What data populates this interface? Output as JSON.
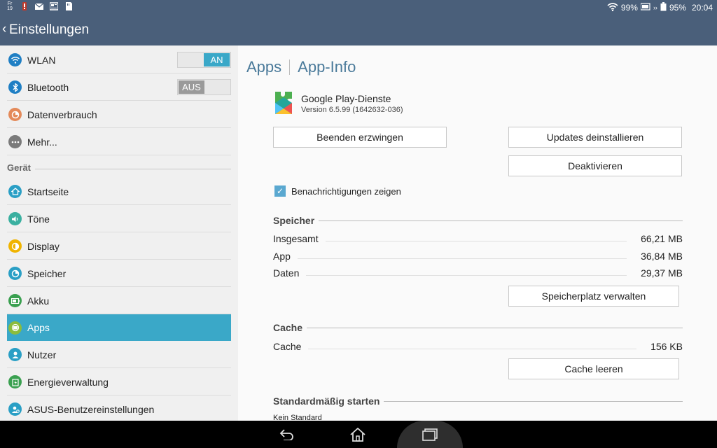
{
  "status_bar": {
    "date_day": "Fr",
    "date_num": "19",
    "wifi_percent": "99%",
    "battery_percent": "95%",
    "time": "20:04",
    "icons": [
      "calendar-icon",
      "warning-icon",
      "mail-icon",
      "news-icon",
      "sd-card-icon",
      "wifi-icon",
      "dock-battery-icon",
      "battery-icon"
    ]
  },
  "action_bar": {
    "title": "Einstellungen"
  },
  "sidebar": {
    "items_top": [
      {
        "label": "WLAN",
        "icon": "wifi-icon",
        "color": "#1f7fc4",
        "toggle": "AN"
      },
      {
        "label": "Bluetooth",
        "icon": "bluetooth-icon",
        "color": "#1f7fc4",
        "toggle": "AUS"
      },
      {
        "label": "Datenverbrauch",
        "icon": "data-usage-icon",
        "color": "#e48a5a"
      },
      {
        "label": "Mehr...",
        "icon": "more-icon",
        "color": "#7a7a7a"
      }
    ],
    "section": "Gerät",
    "items_device": [
      {
        "label": "Startseite",
        "icon": "home-icon",
        "color": "#2a9fc5"
      },
      {
        "label": "Töne",
        "icon": "sound-icon",
        "color": "#3ab0a0"
      },
      {
        "label": "Display",
        "icon": "display-icon",
        "color": "#f0b400"
      },
      {
        "label": "Speicher",
        "icon": "storage-icon",
        "color": "#2a9fc5"
      },
      {
        "label": "Akku",
        "icon": "battery-icon",
        "color": "#3aa050"
      },
      {
        "label": "Apps",
        "icon": "apps-icon",
        "color": "#8cbc3c",
        "active": true
      },
      {
        "label": "Nutzer",
        "icon": "user-icon",
        "color": "#2a9fc5"
      },
      {
        "label": "Energieverwaltung",
        "icon": "energy-icon",
        "color": "#3aa050"
      },
      {
        "label": "ASUS-Benutzereinstellungen",
        "icon": "asus-settings-icon",
        "color": "#2a9fc5"
      }
    ]
  },
  "main": {
    "breadcrumb": [
      "Apps",
      "App-Info"
    ],
    "app_name": "Google Play-Dienste",
    "app_version": "Version 6.5.99 (1642632-036)",
    "btn_force_stop": "Beenden erzwingen",
    "btn_uninstall_updates": "Updates deinstallieren",
    "btn_disable": "Deaktivieren",
    "notifications_label": "Benachrichtigungen zeigen",
    "storage": {
      "title": "Speicher",
      "rows": [
        {
          "label": "Insgesamt",
          "value": "66,21 MB"
        },
        {
          "label": "App",
          "value": "36,84 MB"
        },
        {
          "label": "Daten",
          "value": "29,37 MB"
        }
      ],
      "btn_manage": "Speicherplatz verwalten"
    },
    "cache": {
      "title": "Cache",
      "row": {
        "label": "Cache",
        "value": "156 KB"
      },
      "btn_clear": "Cache leeren"
    },
    "launch_default": {
      "title": "Standardmäßig starten",
      "value": "Kein Standard"
    }
  }
}
